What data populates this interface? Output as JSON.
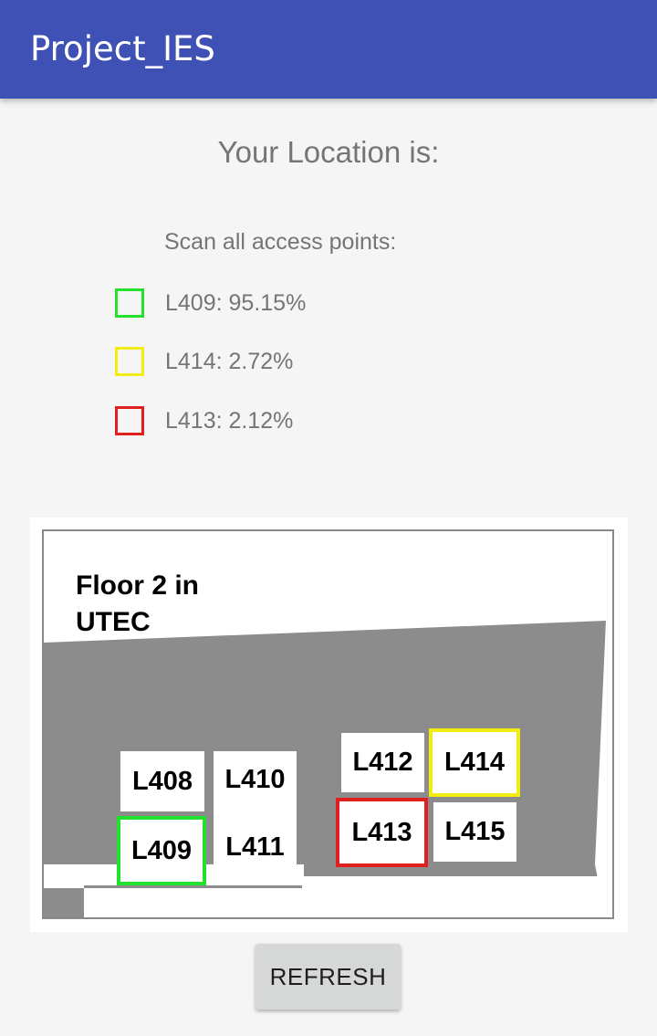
{
  "app_bar": {
    "title": "Project_IES",
    "color": "#3f51b5"
  },
  "location": {
    "heading": "Your Location is:"
  },
  "scan": {
    "label": "Scan all access points:",
    "results": [
      {
        "text": "L409: 95.15%",
        "room": "L409",
        "percent": 95.15,
        "color": "#22e02b"
      },
      {
        "text": "L414: 2.72%",
        "room": "L414",
        "percent": 2.72,
        "color": "#f2ec12"
      },
      {
        "text": "L413: 2.12%",
        "room": "L413",
        "percent": 2.12,
        "color": "#e01f1f"
      }
    ]
  },
  "map": {
    "title": "Floor 2 in UTEC",
    "rooms": [
      {
        "label": "L408",
        "highlight": "none"
      },
      {
        "label": "L410",
        "highlight": "none"
      },
      {
        "label": "L409",
        "highlight": "green"
      },
      {
        "label": "L411",
        "highlight": "none"
      },
      {
        "label": "L412",
        "highlight": "none"
      },
      {
        "label": "L414",
        "highlight": "yellow"
      },
      {
        "label": "L413",
        "highlight": "red"
      },
      {
        "label": "L415",
        "highlight": "none"
      }
    ]
  },
  "actions": {
    "refresh_label": "REFRESH"
  }
}
